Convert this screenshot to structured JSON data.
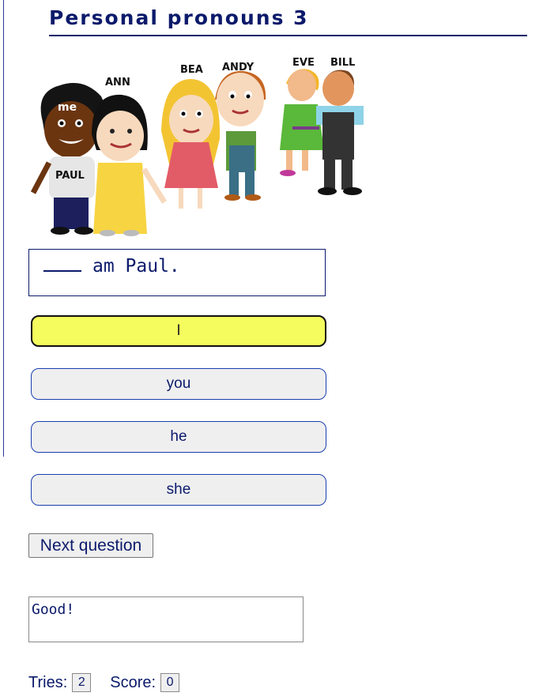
{
  "page": {
    "title": "Personal pronouns 3"
  },
  "illustration": {
    "labels": {
      "me": "me",
      "paul": "PAUL",
      "ann": "ANN",
      "bea": "BEA",
      "andy": "ANDY",
      "eve": "EVE",
      "bill": "BILL"
    }
  },
  "question": {
    "blank": "___",
    "text": "am Paul."
  },
  "choices": [
    {
      "label": "I",
      "selected": true
    },
    {
      "label": "you",
      "selected": false
    },
    {
      "label": "he",
      "selected": false
    },
    {
      "label": "she",
      "selected": false
    }
  ],
  "next_button": {
    "label": "Next question"
  },
  "feedback": {
    "text": "Good!"
  },
  "stats": {
    "tries_label": "Tries:",
    "tries": "2",
    "score_label": "Score:",
    "score": "0"
  },
  "colors": {
    "text": "#0b1a6b",
    "selected_choice": "#f4fd5d",
    "choice_bg": "#efefef",
    "choice_border": "#1a3fb0"
  }
}
